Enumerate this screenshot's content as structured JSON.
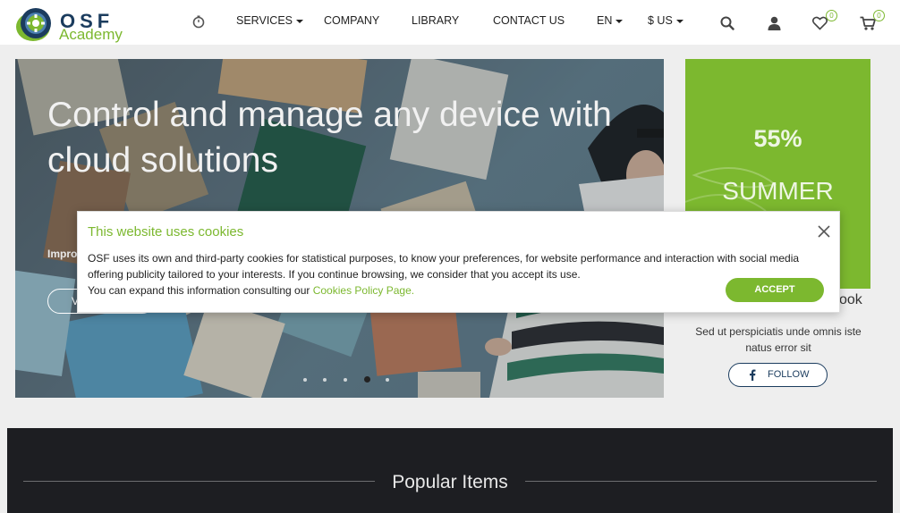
{
  "header": {
    "logo_top": "OSF",
    "logo_bottom": "Academy",
    "nav": {
      "services": "SERVICES",
      "company": "COMPANY",
      "library": "LIBRARY",
      "contact": "CONTACT US",
      "language": "EN",
      "currency": "$ US"
    },
    "wishlist_count": "0",
    "cart_count": "0",
    "icons": [
      "timer-icon",
      "search-icon",
      "user-icon",
      "heart-icon",
      "cart-icon"
    ]
  },
  "hero": {
    "title": "Control and manage any device with cloud solutions",
    "subtitle": "Improv",
    "button_label": "V",
    "slide_count": 5,
    "active_slide": 4
  },
  "promo": {
    "percent": "55%",
    "word": "SUMMER"
  },
  "facebook": {
    "title": "ook",
    "text": "Sed ut perspiciatis unde omnis iste natus error sit",
    "follow_label": "FOLLOW"
  },
  "popular": {
    "title": "Popular Items"
  },
  "cookie": {
    "title": "This website uses cookies",
    "body": "OSF uses its own and third-party cookies for statistical purposes, to know your preferences, for website performance and interaction with social media offering publicity tailored to your interests. If you continue browsing, we consider that you accept its use.",
    "expand_text": "You can expand this information consulting our ",
    "link_text": "Cookies Policy Page",
    "period": ".",
    "accept_label": "ACCEPT"
  },
  "colors": {
    "brand_green": "#7cb82f",
    "brand_navy": "#1b3c5e",
    "dark_section": "#1d1e22"
  }
}
